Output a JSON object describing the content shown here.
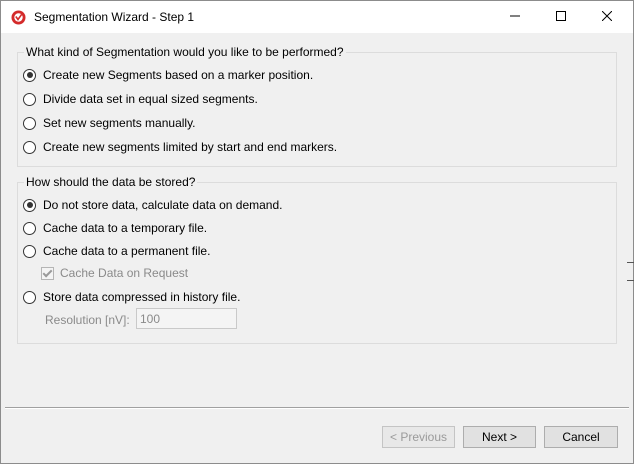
{
  "window": {
    "title": "Segmentation Wizard - Step 1",
    "icon": "app-logo-icon",
    "controls": [
      "minimize-icon",
      "maximize-icon",
      "close-icon"
    ]
  },
  "segmentation": {
    "legend": "What kind of Segmentation would you like to be performed?",
    "options": [
      {
        "label": "Create new Segments based on a marker position.",
        "checked": true
      },
      {
        "label": "Divide data set in equal sized segments.",
        "checked": false
      },
      {
        "label": "Set new segments manually.",
        "checked": false
      },
      {
        "label": "Create new segments limited by start and end markers.",
        "checked": false
      }
    ]
  },
  "storage": {
    "legend": "How should the data be stored?",
    "options": [
      {
        "label": "Do not store data, calculate data on demand.",
        "checked": true
      },
      {
        "label": "Cache data to a temporary file.",
        "checked": false
      },
      {
        "label": "Cache data to a permanent file.",
        "checked": false
      },
      {
        "label": "Store data compressed in history file.",
        "checked": false
      }
    ],
    "cache_checkbox": {
      "label": "Cache Data on Request",
      "checked": true,
      "enabled": false
    },
    "resolution": {
      "label": "Resolution [nV]:",
      "value": "100",
      "enabled": false
    }
  },
  "buttons": {
    "previous": "< Previous",
    "next": "Next >",
    "cancel": "Cancel"
  },
  "colors": {
    "accent_icon": "#d42a2a",
    "window_bg": "#f0f0f0"
  }
}
